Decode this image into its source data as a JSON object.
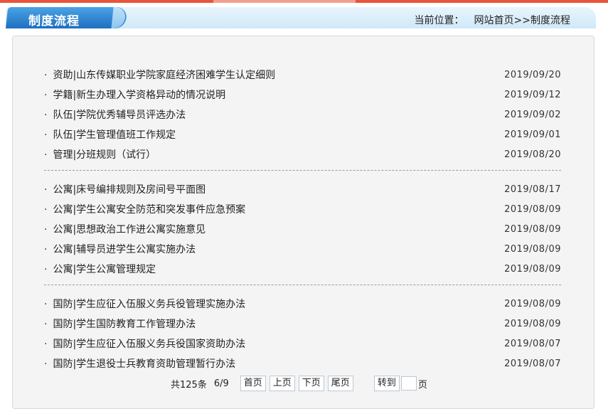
{
  "header": {
    "section_title": "制度流程",
    "location_label": "当前位置：",
    "breadcrumb": "网站首页>>制度流程"
  },
  "groups": [
    {
      "items": [
        {
          "title": "资助|山东传媒职业学院家庭经济困难学生认定细则",
          "date": "2019/09/20"
        },
        {
          "title": "学籍|新生办理入学资格异动的情况说明",
          "date": "2019/09/12"
        },
        {
          "title": "队伍|学院优秀辅导员评选办法",
          "date": "2019/09/02"
        },
        {
          "title": "队伍|学生管理值班工作规定",
          "date": "2019/09/01"
        },
        {
          "title": "管理|分班规则（试行）",
          "date": "2019/08/20"
        }
      ]
    },
    {
      "items": [
        {
          "title": "公寓|床号编排规则及房间号平面图",
          "date": "2019/08/17"
        },
        {
          "title": "公寓|学生公寓安全防范和突发事件应急预案",
          "date": "2019/08/09"
        },
        {
          "title": "公寓|思想政治工作进公寓实施意见",
          "date": "2019/08/09"
        },
        {
          "title": "公寓|辅导员进学生公寓实施办法",
          "date": "2019/08/09"
        },
        {
          "title": "公寓|学生公寓管理规定",
          "date": "2019/08/09"
        }
      ]
    },
    {
      "items": [
        {
          "title": "国防|学生应征入伍服义务兵役管理实施办法",
          "date": "2019/08/09"
        },
        {
          "title": "国防|学生国防教育工作管理办法",
          "date": "2019/08/09"
        },
        {
          "title": "国防|学生应征入伍服义务兵役国家资助办法",
          "date": "2019/08/07"
        },
        {
          "title": "国防|学生退役士兵教育资助管理暂行办法",
          "date": "2019/08/07"
        }
      ]
    }
  ],
  "pager": {
    "total": "共125条",
    "page": "6/9",
    "first": "首页",
    "prev": "上页",
    "next": "下页",
    "last": "尾页",
    "goto": "转到",
    "goto_value": "",
    "page_unit": "页"
  },
  "colors": {
    "accent": "#1f6fc0",
    "header_bg": "#cfe8f8",
    "top_line": "#e8553b"
  }
}
